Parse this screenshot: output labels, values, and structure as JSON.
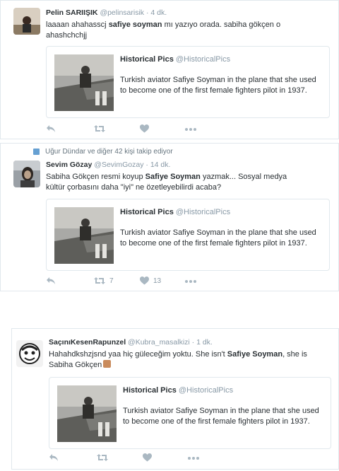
{
  "tweets": [
    {
      "name": "Pelin SARIIŞIK",
      "handle": "@pelinsarisik",
      "time": "· 4 dk.",
      "text_before": "laaaan ahahasscj ",
      "text_bold": "safiye soyman",
      "text_after": " mı yazıyo orada. sabiha gökçen o ahashchchjj",
      "card_title": "Historical Pics",
      "card_handle": "@HistoricalPics",
      "card_text": "Turkish aviator Safiye Soyman in the plane that she used to become one of the first female fighters pilot in 1937.",
      "retweets": "",
      "likes": ""
    },
    {
      "context": "Uğur Dündar ve diğer 42 kişi takip ediyor",
      "name": "Sevim Gözay",
      "handle": "@SevimGozay",
      "time": "· 14 dk.",
      "text_before": "Sabiha Gökçen resmi koyup ",
      "text_bold": "Safiye Soyman",
      "text_after": " yazmak... Sosyal medya kültür çorbasını daha \"iyi\" ne özetleyebilirdi acaba?",
      "card_title": "Historical Pics",
      "card_handle": "@HistoricalPics",
      "card_text": "Turkish aviator Safiye Soyman in the plane that she used to become one of the first female fighters pilot in 1937.",
      "retweets": "7",
      "likes": "13"
    },
    {
      "name": "SaçınıKesenRapunzel",
      "handle": "@Kubra_masalkizi",
      "time": "· 1 dk.",
      "text_before": "Hahahdkshzjsnd yaa hiç güleceğim yoktu. She isn't ",
      "text_bold": "Safiye Soyman",
      "text_after": ", she is Sabiha Gökçen",
      "card_title": "Historical Pics",
      "card_handle": "@HistoricalPics",
      "card_text": "Turkish aviator Safiye Soyman in the plane that she used to become one of the first female fighters pilot in 1937.",
      "retweets": "",
      "likes": ""
    }
  ],
  "icons": {
    "reply": "reply-icon",
    "retweet": "retweet-icon",
    "like": "heart-icon",
    "more": "more-icon",
    "context": "follow-context-icon"
  },
  "colors": {
    "border": "#e1e8ed",
    "meta": "#8899a6",
    "action": "#aab8c2",
    "text": "#292f33"
  }
}
